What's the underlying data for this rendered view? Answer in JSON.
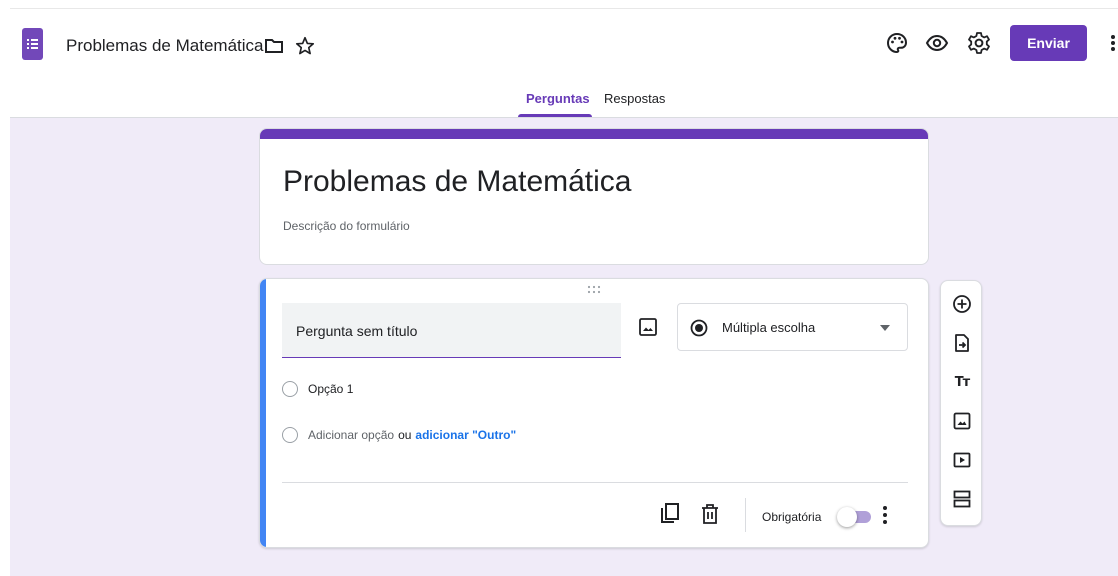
{
  "header": {
    "doc_title": "Problemas de Matemática",
    "send_label": "Enviar",
    "tabs": [
      {
        "label": "Perguntas",
        "active": true
      },
      {
        "label": "Respostas",
        "active": false
      }
    ],
    "icons": [
      "forms-app-icon",
      "folder-icon",
      "star-icon",
      "palette-icon",
      "preview-eye-icon",
      "settings-gear-icon",
      "more-vert-icon"
    ]
  },
  "form": {
    "title": "Problemas de Matemática",
    "description_placeholder": "Descrição do formulário"
  },
  "question": {
    "title_placeholder": "Pergunta sem título",
    "type": "Múltipla escolha",
    "options": [
      "Opção 1"
    ],
    "add_option": "Adicionar opção",
    "or_text": "ou",
    "add_other": "adicionar \"Outro\"",
    "required_label": "Obrigatória",
    "required": false
  },
  "side_toolbar": {
    "tools": [
      "add-question-icon",
      "import-questions-icon",
      "add-title-icon",
      "add-image-icon",
      "add-video-icon",
      "add-section-icon"
    ],
    "title_glyph": "Tт"
  },
  "colors": {
    "brand": "#673ab7",
    "canvas": "#f0ebf8",
    "accent_blue": "#4285f4",
    "link_blue": "#1a73e8"
  }
}
